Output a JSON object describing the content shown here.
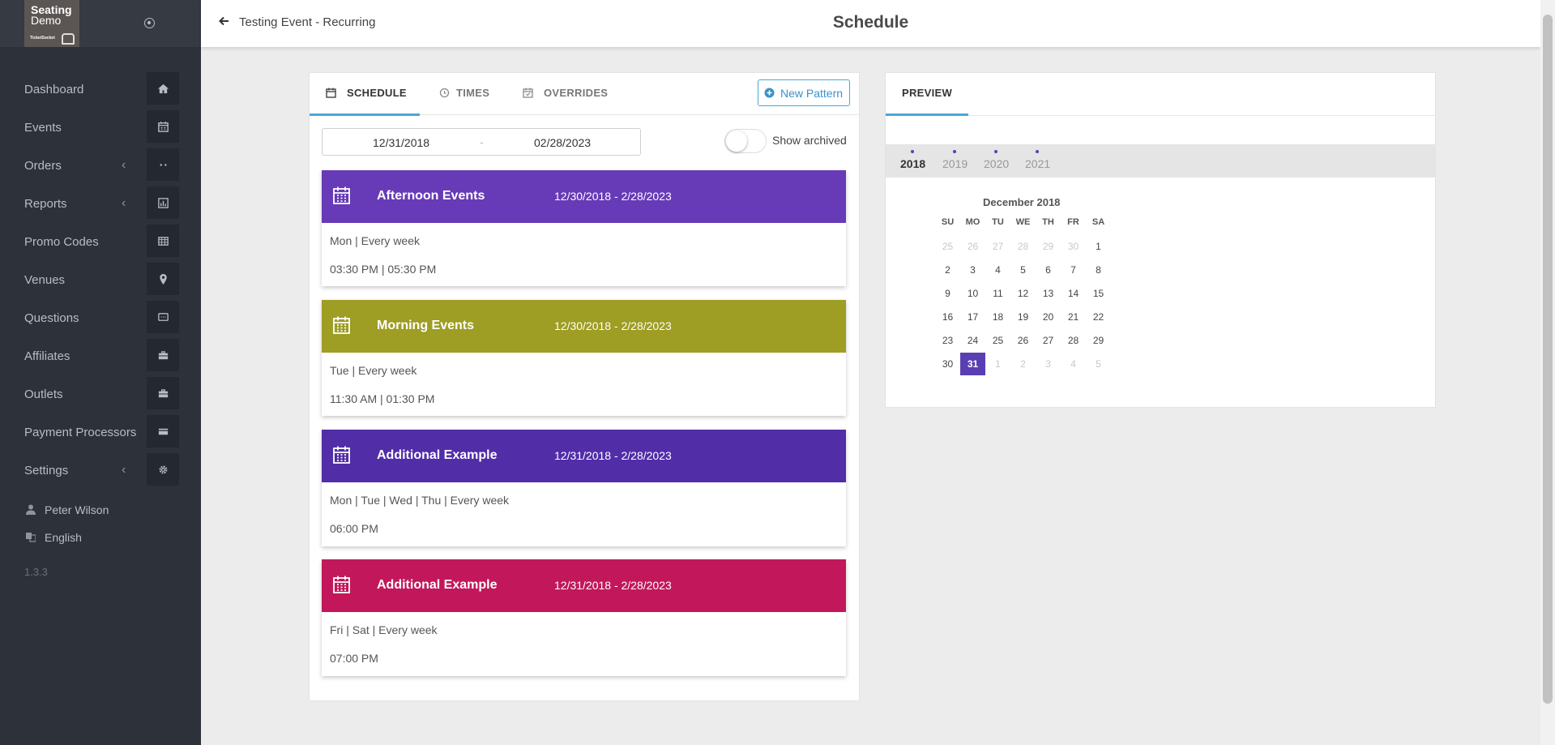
{
  "brand": {
    "line1": "Seating",
    "line2": "Demo",
    "line3": "TicketSocket"
  },
  "sidebar": {
    "items": [
      {
        "label": "Dashboard",
        "icon": "home-icon",
        "chevron": false
      },
      {
        "label": "Events",
        "icon": "calendar-icon",
        "chevron": false
      },
      {
        "label": "Orders",
        "icon": "ellipsis-icon",
        "chevron": true
      },
      {
        "label": "Reports",
        "icon": "bar-chart-icon",
        "chevron": true
      },
      {
        "label": "Promo Codes",
        "icon": "table-icon",
        "chevron": false
      },
      {
        "label": "Venues",
        "icon": "map-pin-icon",
        "chevron": false
      },
      {
        "label": "Questions",
        "icon": "comment-icon",
        "chevron": false
      },
      {
        "label": "Affiliates",
        "icon": "briefcase-icon",
        "chevron": false
      },
      {
        "label": "Outlets",
        "icon": "briefcase-icon",
        "chevron": false
      },
      {
        "label": "Payment Processors",
        "icon": "credit-card-icon",
        "chevron": false
      },
      {
        "label": "Settings",
        "icon": "gear-icon",
        "chevron": true
      }
    ],
    "user": "Peter Wilson",
    "language": "English",
    "version": "1.3.3"
  },
  "header": {
    "back_label": "Testing Event - Recurring",
    "title": "Schedule"
  },
  "schedule": {
    "tabs": [
      {
        "label": "SCHEDULE",
        "icon": "calendar-icon",
        "active": true
      },
      {
        "label": "TIMES",
        "icon": "clock-icon",
        "active": false
      },
      {
        "label": "OVERRIDES",
        "icon": "calendar-check-icon",
        "active": false
      }
    ],
    "new_pattern_label": "New Pattern",
    "date_from": "12/31/2018",
    "date_separator": "-",
    "date_to": "02/28/2023",
    "show_archived_label": "Show archived",
    "show_archived": false,
    "patterns": [
      {
        "title": "Afternoon Events",
        "range": "12/30/2018 - 2/28/2023",
        "days": "Mon | Every week",
        "times": "03:30 PM  | 05:30 PM",
        "color": "#673ab7"
      },
      {
        "title": "Morning Events",
        "range": "12/30/2018 - 2/28/2023",
        "days": "Tue | Every week",
        "times": "11:30 AM  | 01:30 PM",
        "color": "#9e9d24"
      },
      {
        "title": "Additional Example",
        "range": "12/31/2018 - 2/28/2023",
        "days": "Mon | Tue | Wed | Thu | Every week",
        "times": "06:00 PM",
        "color": "#512da8"
      },
      {
        "title": "Additional Example",
        "range": "12/31/2018 - 2/28/2023",
        "days": "Fri | Sat | Every week",
        "times": "07:00 PM",
        "color": "#c2185b"
      }
    ]
  },
  "preview": {
    "tab_label": "PREVIEW",
    "years": [
      "2018",
      "2019",
      "2020",
      "2021"
    ],
    "active_year": "2018",
    "month_title": "December 2018",
    "weekdays": [
      "SU",
      "MO",
      "TU",
      "WE",
      "TH",
      "FR",
      "SA"
    ],
    "weeks": [
      [
        "25",
        "26",
        "27",
        "28",
        "29",
        "30",
        "1"
      ],
      [
        "2",
        "3",
        "4",
        "5",
        "6",
        "7",
        "8"
      ],
      [
        "9",
        "10",
        "11",
        "12",
        "13",
        "14",
        "15"
      ],
      [
        "16",
        "17",
        "18",
        "19",
        "20",
        "21",
        "22"
      ],
      [
        "23",
        "24",
        "25",
        "26",
        "27",
        "28",
        "29"
      ],
      [
        "30",
        "31",
        "1",
        "2",
        "3",
        "4",
        "5"
      ]
    ],
    "selected_day": "31",
    "accent": "#5a3fb3"
  }
}
